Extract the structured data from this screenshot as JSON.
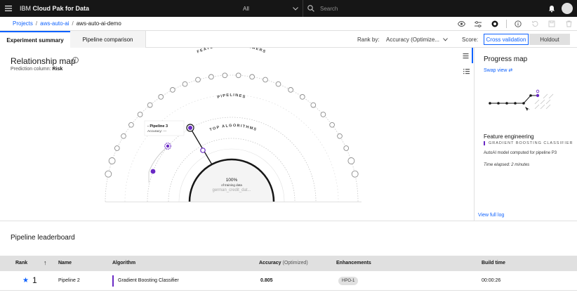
{
  "header": {
    "brand_prefix": "IBM ",
    "brand_name": "Cloud Pak for Data",
    "scope": "All",
    "search_placeholder": "Search"
  },
  "breadcrumb": {
    "items": [
      "Projects",
      "aws-auto-ai"
    ],
    "current": "aws-auto-ai-demo"
  },
  "tabs": {
    "experiment_summary": "Experiment summary",
    "pipeline_comparison": "Pipeline comparison"
  },
  "rank": {
    "label": "Rank by:",
    "selected": "Accuracy (Optimize..."
  },
  "score": {
    "label": "Score:",
    "cross_validation": "Cross validation",
    "holdout": "Holdout"
  },
  "relationship_map": {
    "title": "Relationship map",
    "prediction_label": "Prediction column: ",
    "prediction_value": "Risk",
    "ring_feature": "FEATURE TRANSFORMERS",
    "ring_pipelines": "PIPELINES",
    "ring_algorithms": "TOP ALGORITHMS",
    "tooltip_title": "- Pipeline 3",
    "tooltip_sub": "Accuracy: ---",
    "center_pct": "100%",
    "center_label": "of training data",
    "center_dataset": "german_credit_dat..."
  },
  "progress_map": {
    "title": "Progress map",
    "swap_view": "Swap view",
    "section_title": "Feature engineering",
    "algorithm": "Gradient Boosting Classifier",
    "description": "AutoAI model computed for pipeline P3",
    "elapsed": "Time elapsed: 2 minutes",
    "view_log": "View full log"
  },
  "leaderboard": {
    "title": "Pipeline leaderboard",
    "columns": {
      "rank": "Rank",
      "name": "Name",
      "algorithm": "Algorithm",
      "accuracy": "Accuracy",
      "accuracy_sub": "(Optimized)",
      "enhancements": "Enhancements",
      "build_time": "Build time"
    },
    "rows": [
      {
        "rank": "1",
        "name": "Pipeline 2",
        "algorithm": "Gradient Boosting Classifier",
        "accuracy": "0.805",
        "enhancement": "HPO-1",
        "build_time": "00:00:26"
      }
    ]
  },
  "colors": {
    "accent": "#0f62fe",
    "purple": "#6929c4",
    "header_bg": "#161616"
  }
}
